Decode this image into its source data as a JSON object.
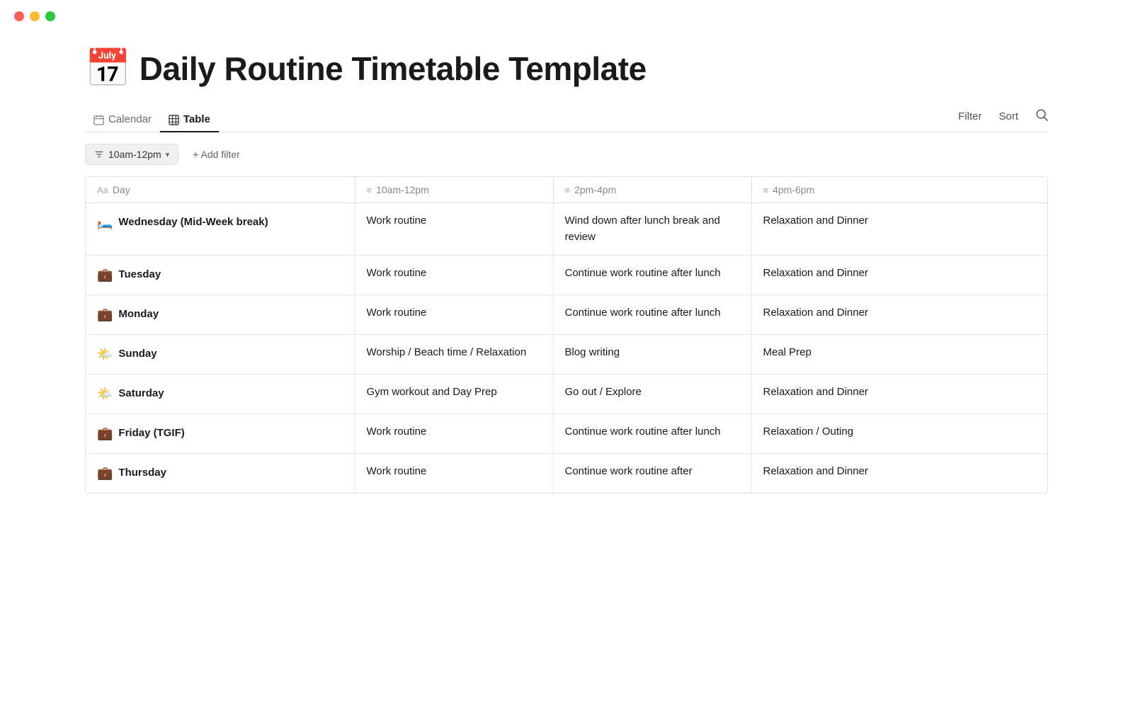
{
  "window": {
    "traffic_lights": [
      "red",
      "yellow",
      "green"
    ]
  },
  "page": {
    "icon": "📅",
    "title": "Daily Routine Timetable Template"
  },
  "views": [
    {
      "id": "calendar",
      "label": "Calendar",
      "icon": "calendar",
      "active": false
    },
    {
      "id": "table",
      "label": "Table",
      "icon": "table",
      "active": true
    }
  ],
  "right_actions": {
    "filter": "Filter",
    "sort": "Sort",
    "search_icon": "search"
  },
  "toolbar": {
    "filter_label": "10am-12pm",
    "add_filter": "+ Add filter"
  },
  "table": {
    "columns": [
      {
        "id": "day",
        "icon": "Aa",
        "label": "Day"
      },
      {
        "id": "10am",
        "icon": "≡",
        "label": "10am-12pm"
      },
      {
        "id": "2pm",
        "icon": "≡",
        "label": "2pm-4pm"
      },
      {
        "id": "4pm",
        "icon": "≡",
        "label": "4pm-6pm"
      }
    ],
    "rows": [
      {
        "day_emoji": "🛏️",
        "day_label": "Wednesday (Mid-Week break)",
        "col_10am": "Work routine",
        "col_2pm": "Wind down after lunch break and review",
        "col_4pm": "Relaxation and Dinner"
      },
      {
        "day_emoji": "💼",
        "day_label": "Tuesday",
        "col_10am": "Work routine",
        "col_2pm": "Continue work routine after lunch",
        "col_4pm": "Relaxation and Dinner"
      },
      {
        "day_emoji": "💼",
        "day_label": "Monday",
        "col_10am": "Work routine",
        "col_2pm": "Continue work routine after lunch",
        "col_4pm": "Relaxation and Dinner"
      },
      {
        "day_emoji": "🌤️",
        "day_label": "Sunday",
        "col_10am": "Worship / Beach time / Relaxation",
        "col_2pm": "Blog writing",
        "col_4pm": "Meal Prep"
      },
      {
        "day_emoji": "🌤️",
        "day_label": "Saturday",
        "col_10am": "Gym workout and Day Prep",
        "col_2pm": "Go out / Explore",
        "col_4pm": "Relaxation and Dinner"
      },
      {
        "day_emoji": "💼",
        "day_label": "Friday (TGIF)",
        "col_10am": "Work routine",
        "col_2pm": "Continue work routine after lunch",
        "col_4pm": "Relaxation / Outing"
      },
      {
        "day_emoji": "💼",
        "day_label": "Thursday",
        "col_10am": "Work routine",
        "col_2pm": "Continue work routine after",
        "col_4pm": "Relaxation and Dinner"
      }
    ]
  }
}
